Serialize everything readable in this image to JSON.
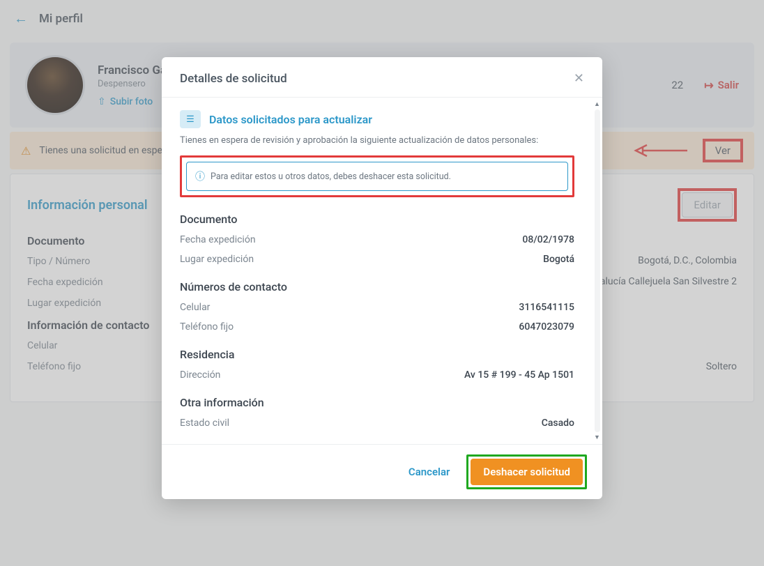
{
  "header": {
    "title": "Mi perfil"
  },
  "profile": {
    "name": "Francisco Ga",
    "role": "Despensero",
    "upload_label": "Subir foto",
    "date": "22",
    "logout_label": "Salir"
  },
  "alert": {
    "text": "Tienes una solicitud en esper",
    "ver_label": "Ver"
  },
  "info": {
    "title": "Información personal",
    "edit_label": "Editar",
    "doc_head": "Documento",
    "tipo_label": "Tipo / Número",
    "fecha_label": "Fecha expedición",
    "lugar_label": "Lugar expedición",
    "contact_head": "Información de contacto",
    "cel_label": "Celular",
    "tel_label": "Teléfono fijo",
    "city_value": "Bogotá, D.C., Colombia",
    "street_value": "alucía Callejuela San Silvestre 2",
    "marital_value": "Soltero"
  },
  "modal": {
    "title": "Detalles de solicitud",
    "section_title": "Datos solicitados para actualizar",
    "section_desc": "Tienes en espera de revisión y aprobación la siguiente actualización de datos personales:",
    "info_text": "Para editar estos u otros datos, debes deshacer esta solicitud.",
    "doc": {
      "head": "Documento",
      "fecha_label": "Fecha expedición",
      "fecha_value": "08/02/1978",
      "lugar_label": "Lugar expedición",
      "lugar_value": "Bogotá"
    },
    "contact": {
      "head": "Números de contacto",
      "cel_label": "Celular",
      "cel_value": "3116541115",
      "tel_label": "Teléfono fijo",
      "tel_value": "6047023079"
    },
    "res": {
      "head": "Residencia",
      "dir_label": "Dirección",
      "dir_value": "Av 15 # 199 - 45 Ap 1501"
    },
    "other": {
      "head": "Otra información",
      "marital_label": "Estado civil",
      "marital_value": "Casado"
    },
    "cancel_label": "Cancelar",
    "undo_label": "Deshacer solicitud"
  }
}
